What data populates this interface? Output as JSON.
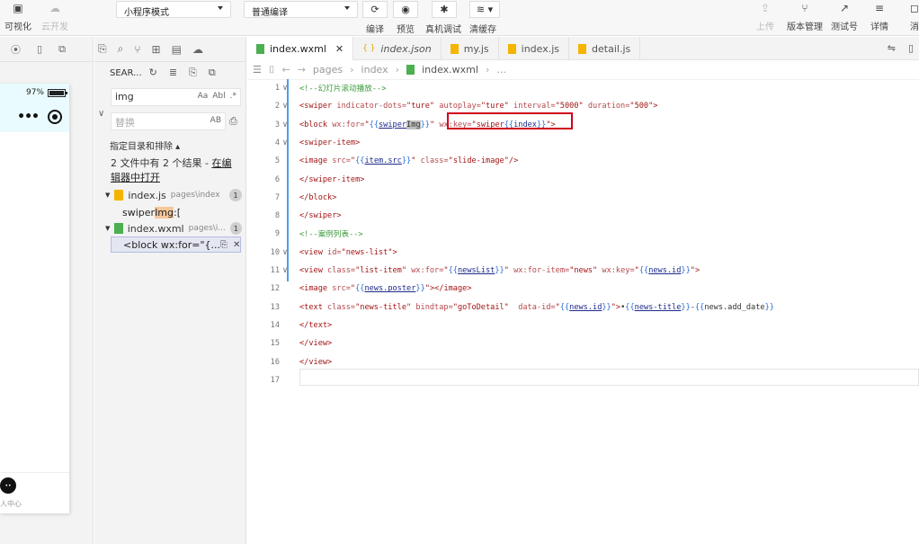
{
  "toolbar": {
    "left_buttons": [
      {
        "label": "可视化",
        "icon": "layout-icon",
        "enabled": true
      },
      {
        "label": "云开发",
        "icon": "cloud-icon",
        "enabled": false
      }
    ],
    "mode_select": "小程序模式",
    "compile_select": "普通编译",
    "middle_buttons": [
      {
        "label": "编译",
        "icon": "refresh-icon"
      },
      {
        "label": "预览",
        "icon": "eye-icon"
      },
      {
        "label": "真机调试",
        "icon": "bug-icon"
      },
      {
        "label": "清缓存",
        "icon": "layers-icon"
      }
    ],
    "right_buttons": [
      {
        "label": "上传",
        "icon": "upload-icon",
        "enabled": false
      },
      {
        "label": "版本管理",
        "icon": "branch-icon",
        "enabled": true
      },
      {
        "label": "测试号",
        "icon": "external-icon",
        "enabled": true
      },
      {
        "label": "详情",
        "icon": "menu-icon",
        "enabled": true
      },
      {
        "label": "消",
        "icon": "bell-icon",
        "enabled": true
      }
    ]
  },
  "simulator": {
    "battery": "97%",
    "battery_level": 0.97,
    "capsule_more": "•••",
    "tab_label": "人中心",
    "tab_avatar": "••"
  },
  "search": {
    "title": "SEAR...",
    "query": "img",
    "query_opts": [
      "Aa",
      "Abl",
      ".*"
    ],
    "replace_placeholder": "替换",
    "replace_opts": [
      "AB"
    ],
    "scope_label": "指定目录和排除 ▴",
    "summary_prefix": "2 文件中有 2 个结果 - ",
    "summary_link": "在编辑器中打开",
    "results": [
      {
        "file": "index.js",
        "path": "pages\\index",
        "count": "1",
        "type": "js",
        "match": {
          "before": "swiper",
          "hit": "Img",
          "after": ":["
        }
      },
      {
        "file": "index.wxml",
        "path": "pages\\i...",
        "count": "1",
        "type": "wxml",
        "match": {
          "before": "<block wx:for=\"{...",
          "hit": "",
          "after": ""
        }
      }
    ]
  },
  "editor": {
    "tabs": [
      {
        "label": "index.wxml",
        "type": "wxml",
        "active": true,
        "closable": true,
        "italic": false
      },
      {
        "label": "index.json",
        "type": "json",
        "active": false,
        "closable": false,
        "italic": true
      },
      {
        "label": "my.js",
        "type": "js",
        "active": false,
        "closable": false,
        "italic": false
      },
      {
        "label": "index.js",
        "type": "js",
        "active": false,
        "closable": false,
        "italic": false
      },
      {
        "label": "detail.js",
        "type": "js",
        "active": false,
        "closable": false,
        "italic": false
      }
    ],
    "breadcrumb": [
      "pages",
      "index",
      "index.wxml",
      "..."
    ],
    "lines": [
      {
        "n": "1",
        "fold": "∨",
        "tokens": [
          [
            "c-com",
            "<!--幻灯片滚动播放-->"
          ]
        ]
      },
      {
        "n": "2",
        "fold": "∨",
        "tokens": [
          [
            "c-tag",
            "<swiper"
          ],
          [
            "c-attr",
            " indicator-dots="
          ],
          [
            "c-str",
            "\"ture\""
          ],
          [
            "c-attr",
            " autoplay="
          ],
          [
            "c-str",
            "\"ture\""
          ],
          [
            "c-attr",
            " interval="
          ],
          [
            "c-str",
            "\"5000\""
          ],
          [
            "c-attr",
            " duration="
          ],
          [
            "c-str",
            "\"500\""
          ],
          [
            "c-tag",
            ">"
          ]
        ]
      },
      {
        "n": "3",
        "fold": "∨",
        "tokens": [
          [
            "c-tag",
            "<block"
          ],
          [
            "c-attr",
            " wx:for="
          ],
          [
            "c-str",
            "\""
          ],
          [
            "c-mus",
            "{{"
          ],
          [
            "c-var",
            "swiper"
          ],
          [
            "c-hl",
            "Img"
          ],
          [
            "c-mus",
            "}}"
          ],
          [
            "c-str",
            "\""
          ],
          [
            "c-plain",
            " "
          ],
          [
            "c-attr",
            "wx:key="
          ],
          [
            "c-str",
            "\"swiper"
          ],
          [
            "c-mus",
            "{{"
          ],
          [
            "c-var",
            "index"
          ],
          [
            "c-mus",
            "}}"
          ],
          [
            "c-str",
            "\""
          ],
          [
            "c-tag",
            ">"
          ]
        ]
      },
      {
        "n": "4",
        "fold": "∨",
        "tokens": [
          [
            "c-tag",
            "<swiper-item>"
          ]
        ]
      },
      {
        "n": "5",
        "fold": "",
        "tokens": [
          [
            "c-tag",
            "<image"
          ],
          [
            "c-attr",
            " src="
          ],
          [
            "c-str",
            "\""
          ],
          [
            "c-mus",
            "{{"
          ],
          [
            "c-var",
            "item.src"
          ],
          [
            "c-mus",
            "}}"
          ],
          [
            "c-str",
            "\""
          ],
          [
            "c-attr",
            " class="
          ],
          [
            "c-str",
            "\"slide-image\""
          ],
          [
            "c-tag",
            "/>"
          ]
        ]
      },
      {
        "n": "6",
        "fold": "",
        "tokens": [
          [
            "c-tag",
            "</swiper-item>"
          ]
        ]
      },
      {
        "n": "7",
        "fold": "",
        "tokens": [
          [
            "c-tag",
            "</block>"
          ]
        ]
      },
      {
        "n": "8",
        "fold": "",
        "tokens": [
          [
            "c-tag",
            "</swiper>"
          ]
        ]
      },
      {
        "n": "9",
        "fold": "",
        "tokens": [
          [
            "c-com",
            "<!--案例列表-->"
          ]
        ]
      },
      {
        "n": "10",
        "fold": "∨",
        "tokens": [
          [
            "c-tag",
            "<view"
          ],
          [
            "c-attr",
            " id="
          ],
          [
            "c-str",
            "\"news-list\""
          ],
          [
            "c-tag",
            ">"
          ]
        ]
      },
      {
        "n": "11",
        "fold": "∨",
        "tokens": [
          [
            "c-tag",
            "<view"
          ],
          [
            "c-attr",
            " class="
          ],
          [
            "c-str",
            "\"list-item\""
          ],
          [
            "c-attr",
            " wx:for="
          ],
          [
            "c-str",
            "\""
          ],
          [
            "c-mus",
            "{{"
          ],
          [
            "c-var",
            "newsList"
          ],
          [
            "c-mus",
            "}}"
          ],
          [
            "c-str",
            "\""
          ],
          [
            "c-attr",
            " wx:for-item="
          ],
          [
            "c-str",
            "\"news\""
          ],
          [
            "c-attr",
            " wx:key="
          ],
          [
            "c-str",
            "\""
          ],
          [
            "c-mus",
            "{{"
          ],
          [
            "c-var",
            "news.id"
          ],
          [
            "c-mus",
            "}}"
          ],
          [
            "c-str",
            "\""
          ],
          [
            "c-tag",
            ">"
          ]
        ]
      },
      {
        "n": "12",
        "fold": "",
        "tokens": [
          [
            "c-tag",
            "<image"
          ],
          [
            "c-attr",
            " src="
          ],
          [
            "c-str",
            "\""
          ],
          [
            "c-mus",
            "{{"
          ],
          [
            "c-var",
            "news.poster"
          ],
          [
            "c-mus",
            "}}"
          ],
          [
            "c-str",
            "\""
          ],
          [
            "c-tag",
            "></image>"
          ]
        ]
      },
      {
        "n": "13",
        "fold": "",
        "tokens": [
          [
            "c-tag",
            "<text"
          ],
          [
            "c-attr",
            " class="
          ],
          [
            "c-str",
            "\"news-title\""
          ],
          [
            "c-attr",
            " bindtap="
          ],
          [
            "c-str",
            "\"goToDetail\""
          ],
          [
            "c-attr",
            "  data-id="
          ],
          [
            "c-str",
            "\""
          ],
          [
            "c-mus",
            "{{"
          ],
          [
            "c-var",
            "news.id"
          ],
          [
            "c-mus",
            "}}"
          ],
          [
            "c-str",
            "\""
          ],
          [
            "c-tag",
            ">"
          ],
          [
            "c-plain",
            "•"
          ],
          [
            "c-mus",
            "{{"
          ],
          [
            "c-var",
            "news-title"
          ],
          [
            "c-mus",
            "}}"
          ],
          [
            "c-plain",
            "-"
          ],
          [
            "c-mus",
            "{{"
          ],
          [
            "c-plain",
            "news.add_date"
          ],
          [
            "c-mus",
            "}}"
          ]
        ]
      },
      {
        "n": "14",
        "fold": "",
        "tokens": [
          [
            "c-tag",
            "</text>"
          ]
        ]
      },
      {
        "n": "15",
        "fold": "",
        "tokens": [
          [
            "c-tag",
            "</view>"
          ]
        ]
      },
      {
        "n": "16",
        "fold": "",
        "tokens": [
          [
            "c-tag",
            "</view>"
          ]
        ]
      },
      {
        "n": "17",
        "fold": "",
        "tokens": []
      }
    ]
  }
}
